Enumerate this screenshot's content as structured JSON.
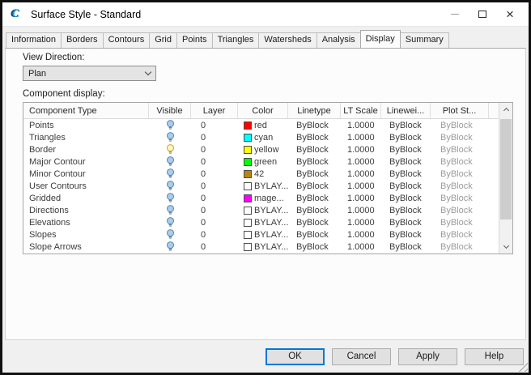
{
  "window": {
    "title": "Surface Style - Standard",
    "app_icon_letter": "C"
  },
  "tabs": [
    {
      "label": "Information",
      "active": false
    },
    {
      "label": "Borders",
      "active": false
    },
    {
      "label": "Contours",
      "active": false
    },
    {
      "label": "Grid",
      "active": false
    },
    {
      "label": "Points",
      "active": false
    },
    {
      "label": "Triangles",
      "active": false
    },
    {
      "label": "Watersheds",
      "active": false
    },
    {
      "label": "Analysis",
      "active": false
    },
    {
      "label": "Display",
      "active": true
    },
    {
      "label": "Summary",
      "active": false
    }
  ],
  "view_direction": {
    "label": "View Direction:",
    "value": "Plan"
  },
  "component_display": {
    "label": "Component display:",
    "columns": [
      "Component Type",
      "Visible",
      "Layer",
      "Color",
      "Linetype",
      "LT Scale",
      "Linewei...",
      "Plot St..."
    ],
    "rows": [
      {
        "component": "Points",
        "bulb": "blue",
        "layer": "0",
        "color_hex": "#FF0000",
        "color_name": "red",
        "linetype": "ByBlock",
        "lt_scale": "1.0000",
        "lineweight": "ByBlock",
        "plot_style": "ByBlock"
      },
      {
        "component": "Triangles",
        "bulb": "blue",
        "layer": "0",
        "color_hex": "#00FFFF",
        "color_name": "cyan",
        "linetype": "ByBlock",
        "lt_scale": "1.0000",
        "lineweight": "ByBlock",
        "plot_style": "ByBlock"
      },
      {
        "component": "Border",
        "bulb": "yellow",
        "layer": "0",
        "color_hex": "#FFFF00",
        "color_name": "yellow",
        "linetype": "ByBlock",
        "lt_scale": "1.0000",
        "lineweight": "ByBlock",
        "plot_style": "ByBlock"
      },
      {
        "component": "Major Contour",
        "bulb": "blue",
        "layer": "0",
        "color_hex": "#00FF00",
        "color_name": "green",
        "linetype": "ByBlock",
        "lt_scale": "1.0000",
        "lineweight": "ByBlock",
        "plot_style": "ByBlock"
      },
      {
        "component": "Minor Contour",
        "bulb": "blue",
        "layer": "0",
        "color_hex": "#B8860B",
        "color_name": "42",
        "linetype": "ByBlock",
        "lt_scale": "1.0000",
        "lineweight": "ByBlock",
        "plot_style": "ByBlock"
      },
      {
        "component": "User Contours",
        "bulb": "blue",
        "layer": "0",
        "color_hex": "#FFFFFF",
        "color_name": "BYLAY...",
        "linetype": "ByBlock",
        "lt_scale": "1.0000",
        "lineweight": "ByBlock",
        "plot_style": "ByBlock"
      },
      {
        "component": "Gridded",
        "bulb": "blue",
        "layer": "0",
        "color_hex": "#FF00FF",
        "color_name": "mage...",
        "linetype": "ByBlock",
        "lt_scale": "1.0000",
        "lineweight": "ByBlock",
        "plot_style": "ByBlock"
      },
      {
        "component": "Directions",
        "bulb": "blue",
        "layer": "0",
        "color_hex": "#FFFFFF",
        "color_name": "BYLAY...",
        "linetype": "ByBlock",
        "lt_scale": "1.0000",
        "lineweight": "ByBlock",
        "plot_style": "ByBlock"
      },
      {
        "component": "Elevations",
        "bulb": "blue",
        "layer": "0",
        "color_hex": "#FFFFFF",
        "color_name": "BYLAY...",
        "linetype": "ByBlock",
        "lt_scale": "1.0000",
        "lineweight": "ByBlock",
        "plot_style": "ByBlock"
      },
      {
        "component": "Slopes",
        "bulb": "blue",
        "layer": "0",
        "color_hex": "#FFFFFF",
        "color_name": "BYLAY...",
        "linetype": "ByBlock",
        "lt_scale": "1.0000",
        "lineweight": "ByBlock",
        "plot_style": "ByBlock"
      },
      {
        "component": "Slope Arrows",
        "bulb": "blue",
        "layer": "0",
        "color_hex": "#FFFFFF",
        "color_name": "BYLAY...",
        "linetype": "ByBlock",
        "lt_scale": "1.0000",
        "lineweight": "ByBlock",
        "plot_style": "ByBlock"
      }
    ]
  },
  "buttons": [
    {
      "label": "OK",
      "default": true
    },
    {
      "label": "Cancel",
      "default": false
    },
    {
      "label": "Apply",
      "default": false
    },
    {
      "label": "Help",
      "default": false
    }
  ]
}
